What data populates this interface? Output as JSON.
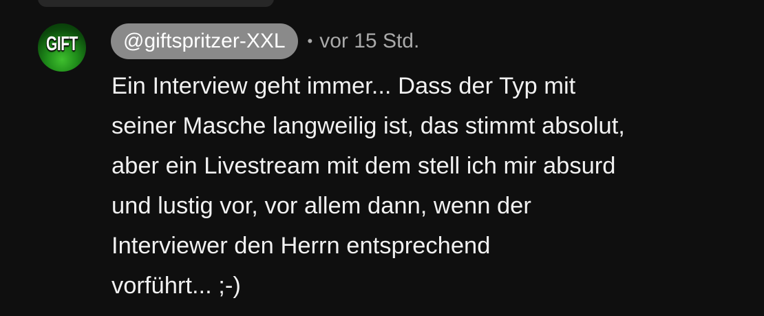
{
  "comment": {
    "avatar_text": "GIFT",
    "author_handle": "@giftspritzer-XXL",
    "separator": "•",
    "timestamp": "vor 15 Std.",
    "text": "Ein Interview geht immer... Dass der Typ mit\nseiner Masche langweilig ist, das stimmt absolut,\naber ein Livestream mit dem stell ich mir absurd\nund lustig vor, vor allem dann, wenn der\nInterviewer den Herrn entsprechend\nvorführt... ;-)"
  }
}
